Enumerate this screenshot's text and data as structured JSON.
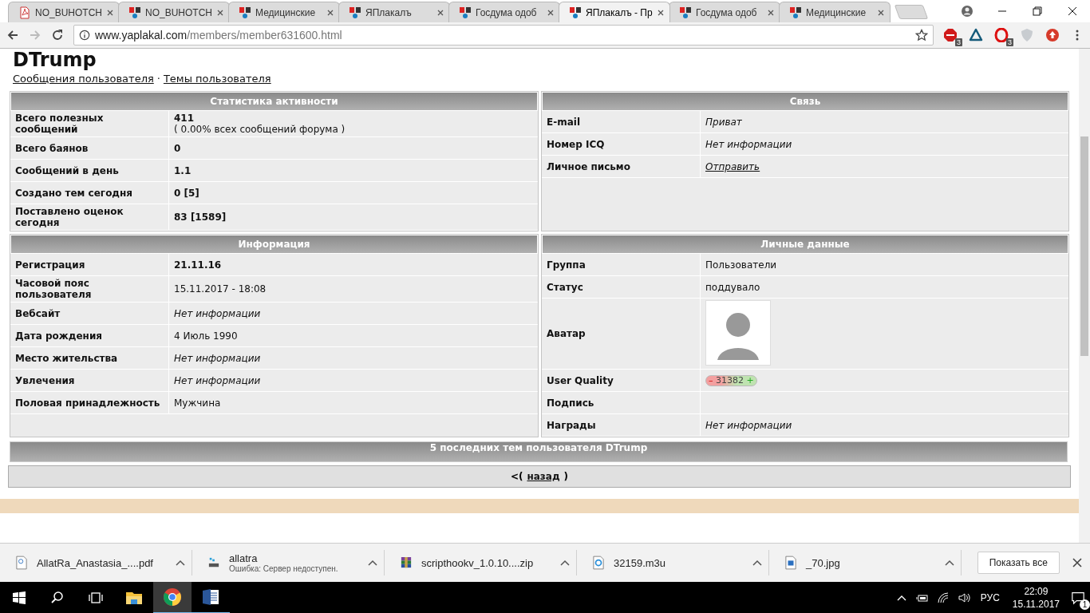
{
  "tabs": [
    {
      "kind": "pdf",
      "label": "NO_BUHOTCH",
      "selected": false
    },
    {
      "kind": "site",
      "label": "NO_BUHOTCH",
      "selected": false
    },
    {
      "kind": "site",
      "label": "Медицинские",
      "selected": false
    },
    {
      "kind": "site",
      "label": "ЯПлакалъ",
      "selected": false
    },
    {
      "kind": "site",
      "label": "Госдума одоб",
      "selected": false
    },
    {
      "kind": "site",
      "label": "ЯПлакалъ - Пр",
      "selected": true
    },
    {
      "kind": "site",
      "label": "Госдума одоб",
      "selected": false
    },
    {
      "kind": "site",
      "label": "Медицинские",
      "selected": false
    }
  ],
  "address": {
    "host": "www.yaplakal.com",
    "path": "/members/member631600.html"
  },
  "extensions": [
    {
      "kind": "abp",
      "badge": "3"
    },
    {
      "kind": "triangle"
    },
    {
      "kind": "opera",
      "badge": "3"
    },
    {
      "kind": "shield"
    },
    {
      "kind": "upload"
    }
  ],
  "page": {
    "title": "DTrump",
    "links": [
      "Сообщения пользователя",
      "Темы пользователя"
    ],
    "link_separator": "·",
    "panels": [
      {
        "title": "Статистика активности",
        "rows": [
          {
            "label": "Всего полезных сообщений",
            "kind": "bold",
            "value": "411",
            "note": "( 0.00% всех сообщений форума )"
          },
          {
            "label": "Всего баянов",
            "kind": "bold",
            "value": "0"
          },
          {
            "label": "Сообщений в день",
            "kind": "bold",
            "value": "1.1"
          },
          {
            "label": "Создано тем сегодня",
            "kind": "bold",
            "value": "0 [5]"
          },
          {
            "label": "Поставлено оценок сегодня",
            "kind": "bold",
            "value": "83 [1589]"
          }
        ]
      },
      {
        "title": "Связь",
        "rows": [
          {
            "label": "E-mail",
            "kind": "italic",
            "value": "Приват"
          },
          {
            "label": "Номер ICQ",
            "kind": "italic",
            "value": "Нет информации"
          },
          {
            "label": "Личное письмо",
            "kind": "link",
            "value": "Отправить"
          }
        ]
      },
      {
        "title": "Информация",
        "rows": [
          {
            "label": "Регистрация",
            "kind": "bold",
            "value": "21.11.16"
          },
          {
            "label": "Часовой пояс пользователя",
            "kind": "plain",
            "value": "15.11.2017 - 18:08"
          },
          {
            "label": "Вебсайт",
            "kind": "italic",
            "value": "Нет информации"
          },
          {
            "label": "Дата рождения",
            "kind": "plain",
            "value": "4 Июль 1990"
          },
          {
            "label": "Место жительства",
            "kind": "italic",
            "value": "Нет информации"
          },
          {
            "label": "Увлечения",
            "kind": "italic",
            "value": "Нет информации"
          },
          {
            "label": "Половая принадлежность",
            "kind": "plain",
            "value": "Мужчина"
          }
        ]
      },
      {
        "title": "Личные данные",
        "rows": [
          {
            "label": "Группа",
            "kind": "plain",
            "value": "Пользователи"
          },
          {
            "label": "Статус",
            "kind": "plain",
            "value": "поддувало"
          },
          {
            "label": "Аватар",
            "kind": "avatar"
          },
          {
            "label": "User Quality",
            "kind": "quality",
            "value": "31382",
            "minus": "–",
            "plus": "+"
          },
          {
            "label": "Подпись",
            "kind": "empty"
          },
          {
            "label": "Награды",
            "kind": "italic",
            "value": "Нет информации"
          }
        ]
      }
    ],
    "recent_header": "5 последних тем пользователя DTrump",
    "back": {
      "before": "<(",
      "link": "назад",
      "after": ")"
    }
  },
  "downloads": [
    {
      "kind": "pdf",
      "name": "AllatRa_Anastasia_....pdf"
    },
    {
      "kind": "app",
      "name": "allatra",
      "status": "Ошибка: Сервер недоступен."
    },
    {
      "kind": "archive",
      "name": "scripthookv_1.0.10....zip"
    },
    {
      "kind": "audio",
      "name": "32159.m3u"
    },
    {
      "kind": "image",
      "name": "_70.jpg"
    }
  ],
  "show_all": "Показать все",
  "taskbar": {
    "apps": [
      {
        "kind": "explorer",
        "selected": false,
        "running": false
      },
      {
        "kind": "chrome",
        "selected": true,
        "running": true
      },
      {
        "kind": "word",
        "selected": false,
        "running": true
      }
    ],
    "language": "РУС",
    "time": "22:09",
    "date": "15.11.2017",
    "notifications": "1"
  }
}
